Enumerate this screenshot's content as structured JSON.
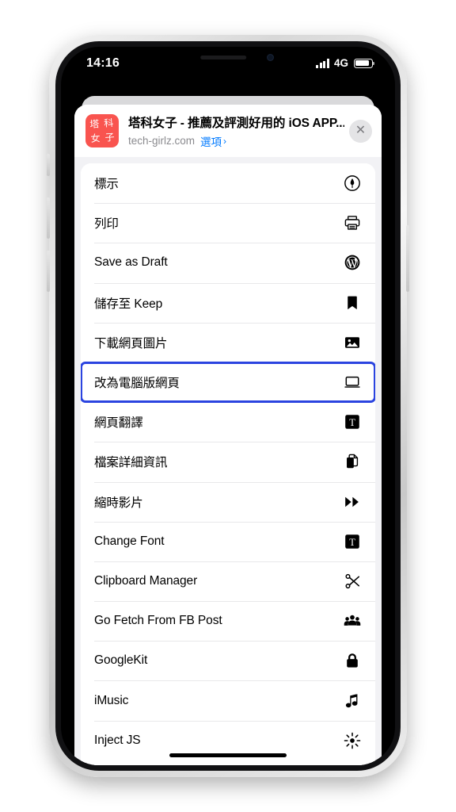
{
  "status_bar": {
    "time": "14:16",
    "network": "4G",
    "signal_icon": "signal-bars-icon",
    "battery_icon": "battery-icon"
  },
  "share_sheet": {
    "app_icon_glyphs": [
      "塔",
      "科",
      "女",
      "子"
    ],
    "app_icon_color": "#f9544f",
    "title": "塔科女子 - 推薦及評測好用的 iOS APP...",
    "url": "tech-girlz.com",
    "options_label": "選項",
    "options_chevron": "›",
    "close_label": "✕",
    "accent_color": "#007aff",
    "highlight_color": "#2b44e0",
    "actions": [
      {
        "label": "標示",
        "icon": "markup-icon"
      },
      {
        "label": "列印",
        "icon": "printer-icon"
      },
      {
        "label": "Save as Draft",
        "icon": "wordpress-icon"
      },
      {
        "label": "儲存至 Keep",
        "icon": "bookmark-icon"
      },
      {
        "label": "下載網頁圖片",
        "icon": "photo-icon"
      },
      {
        "label": "改為電腦版網頁",
        "icon": "desktop-icon",
        "highlighted": true
      },
      {
        "label": "網頁翻譯",
        "icon": "translate-icon"
      },
      {
        "label": "檔案詳細資訊",
        "icon": "documents-icon"
      },
      {
        "label": "縮時影片",
        "icon": "fast-forward-icon"
      },
      {
        "label": "Change Font",
        "icon": "font-icon"
      },
      {
        "label": "Clipboard Manager",
        "icon": "scissors-icon"
      },
      {
        "label": "Go Fetch From FB Post",
        "icon": "people-icon"
      },
      {
        "label": "GoogleKit",
        "icon": "lock-icon"
      },
      {
        "label": "iMusic",
        "icon": "music-note-icon"
      },
      {
        "label": "Inject JS",
        "icon": "sparkle-icon"
      }
    ]
  }
}
